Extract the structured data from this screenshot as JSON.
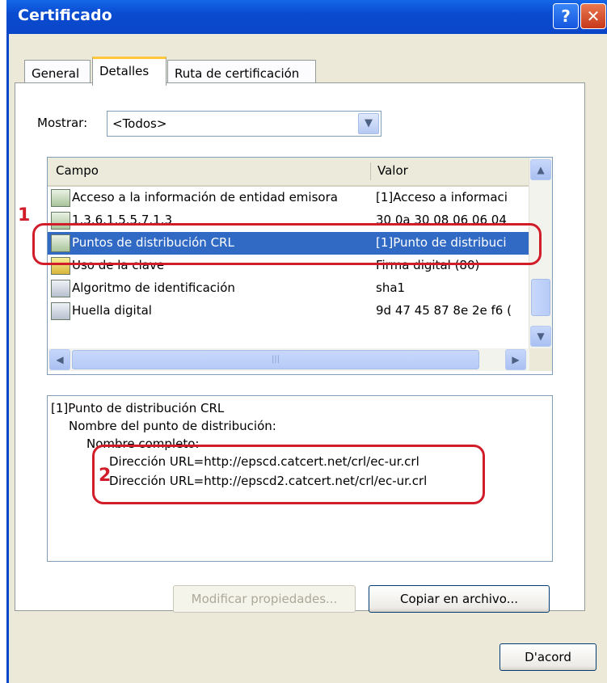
{
  "window": {
    "title": "Certificado",
    "help_glyph": "?",
    "close_glyph": "✕"
  },
  "tabs": [
    {
      "label": "General"
    },
    {
      "label": "Detalles"
    },
    {
      "label": "Ruta de certificación"
    }
  ],
  "show": {
    "label": "Mostrar:",
    "value": "<Todos>"
  },
  "list": {
    "columns": [
      "Campo",
      "Valor"
    ],
    "rows": [
      {
        "field": "Acceso a la información de entidad emisora",
        "value": "[1]Acceso a informaci",
        "icon": "ext-icon"
      },
      {
        "field": "1.3.6.1.5.5.7.1.3",
        "value": "30 0a 30 08 06 06 04",
        "icon": "ext-icon"
      },
      {
        "field": "Puntos de distribución CRL",
        "value": "[1]Punto de distribuci",
        "icon": "ext-icon",
        "selected": true
      },
      {
        "field": "Uso de la clave",
        "value": "Firma digital (80)",
        "icon": "warning-ext-icon"
      },
      {
        "field": "Algoritmo de identificación",
        "value": "sha1",
        "icon": "cert-field-icon"
      },
      {
        "field": "Huella digital",
        "value": "9d 47 45 87 8e 2e f6 (",
        "icon": "cert-field-icon"
      }
    ]
  },
  "detail": {
    "lines": [
      "[1]Punto de distribución CRL",
      "Nombre del punto de distribución:",
      "Nombre completo:",
      "Dirección URL=http://epscd.catcert.net/crl/ec-ur.crl",
      "Dirección URL=http://epscd2.catcert.net/crl/ec-ur.crl"
    ]
  },
  "buttons": {
    "modify": "Modificar propiedades...",
    "copy": "Copiar en archivo...",
    "ok": "D'acord"
  },
  "annotations": {
    "one": "1",
    "two": "2"
  },
  "colors": {
    "annotation": "#d11d2a",
    "selection": "#316ac5",
    "titlebar": "#0a46c8"
  }
}
